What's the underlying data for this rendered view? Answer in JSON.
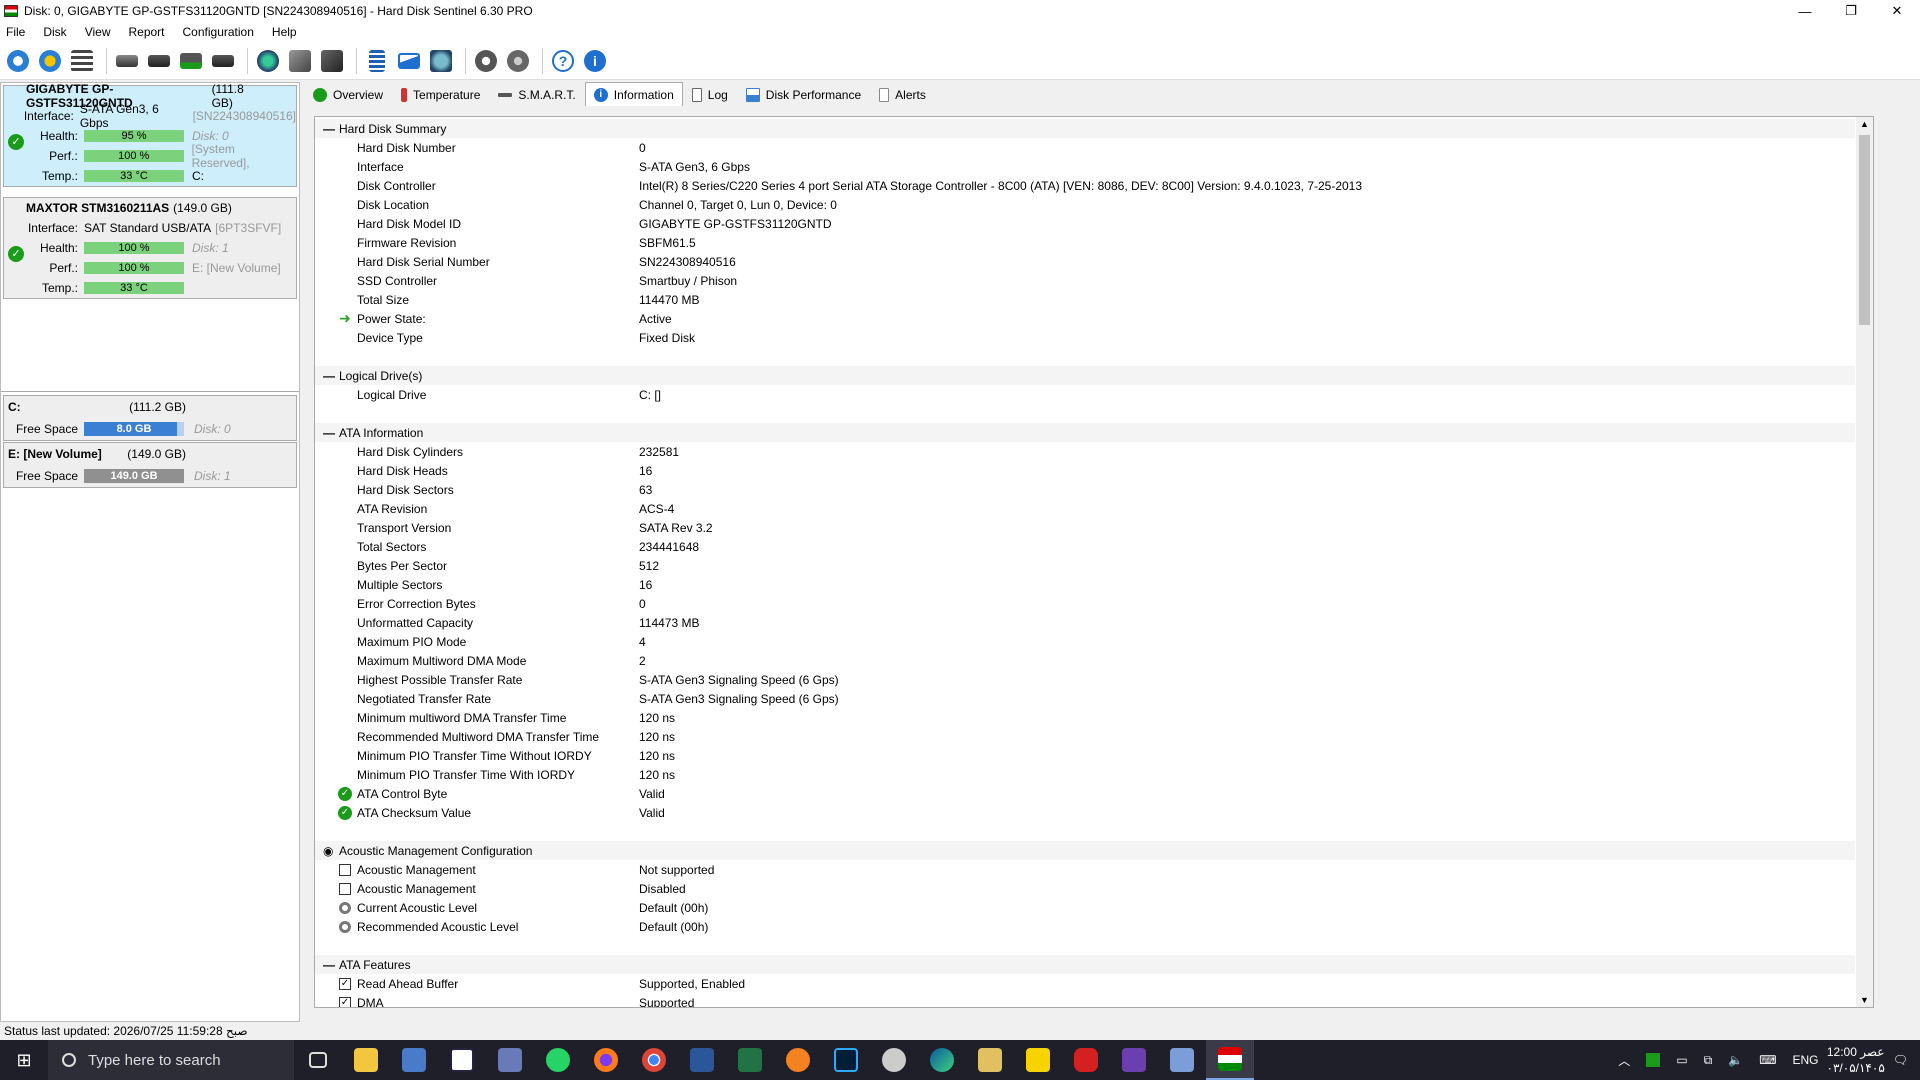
{
  "window": {
    "title": "Disk: 0, GIGABYTE GP-GSTFS31120GNTD [SN224308940516]  -  Hard Disk Sentinel 6.30 PRO",
    "controls": [
      "—",
      "❐",
      "✕"
    ]
  },
  "menu": [
    "File",
    "Disk",
    "View",
    "Report",
    "Configuration",
    "Help"
  ],
  "toolbar": {
    "icons": [
      "refresh-icon",
      "refresh-warning-icon",
      "disk-list-icon",
      "disk-icon",
      "disk-clock-icon",
      "disk-check-icon",
      "disk-search-icon",
      "globe-icon",
      "disk-tools-icon",
      "disk-export-icon",
      "report-icon",
      "mail-icon",
      "network-icon",
      "settings-icon",
      "sound-icon",
      "help-icon",
      "info-icon"
    ]
  },
  "disks": [
    {
      "name": "GIGABYTE GP-GSTFS31120GNTD",
      "size": "(111.8 GB)",
      "interface_label": "Interface:",
      "interface": "S-ATA Gen3, 6 Gbps",
      "serial": "[SN224308940516]",
      "health_label": "Health:",
      "health": "95 %",
      "disk_no": "Disk: 0",
      "perf_label": "Perf.:",
      "perf": "100 %",
      "perf_extra": "[System Reserved],",
      "temp_label": "Temp.:",
      "temp": "33 °C",
      "temp_extra": "C:"
    },
    {
      "name": "MAXTOR STM3160211AS",
      "size": "(149.0 GB)",
      "interface_label": "Interface:",
      "interface": "SAT Standard USB/ATA",
      "serial": "[6PT3SFVF]",
      "health_label": "Health:",
      "health": "100 %",
      "disk_no": "Disk: 1",
      "perf_label": "Perf.:",
      "perf": "100 %",
      "perf_extra": "E: [New Volume]",
      "temp_label": "Temp.:",
      "temp": "33 °C",
      "temp_extra": ""
    }
  ],
  "volumes": [
    {
      "name": "C:",
      "size": "(111.2 GB)",
      "free_label": "Free Space",
      "free": "8.0 GB",
      "disk": "Disk: 0",
      "color": "#3b7fd4"
    },
    {
      "name": "E: [New Volume]",
      "size": "(149.0 GB)",
      "free_label": "Free Space",
      "free": "149.0 GB",
      "disk": "Disk: 1",
      "color": "#909090"
    }
  ],
  "tabs": [
    "Overview",
    "Temperature",
    "S.M.A.R.T.",
    "Information",
    "Log",
    "Disk Performance",
    "Alerts"
  ],
  "sections": [
    {
      "title": "Hard Disk Summary",
      "items": [
        {
          "k": "Hard Disk Number",
          "v": "0"
        },
        {
          "k": "Interface",
          "v": "S-ATA Gen3, 6 Gbps"
        },
        {
          "k": "Disk Controller",
          "v": "Intel(R) 8 Series/C220 Series 4 port Serial ATA Storage Controller - 8C00 (ATA) [VEN: 8086, DEV: 8C00] Version: 9.4.0.1023, 7-25-2013"
        },
        {
          "k": "Disk Location",
          "v": "Channel 0, Target 0, Lun 0, Device: 0"
        },
        {
          "k": "Hard Disk Model ID",
          "v": "GIGABYTE GP-GSTFS31120GNTD"
        },
        {
          "k": "Firmware Revision",
          "v": "SBFM61.5"
        },
        {
          "k": "Hard Disk Serial Number",
          "v": "SN224308940516"
        },
        {
          "k": "SSD Controller",
          "v": "Smartbuy / Phison"
        },
        {
          "k": "Total Size",
          "v": "114470 MB"
        },
        {
          "k": "Power State:",
          "v": "Active"
        },
        {
          "k": "Device Type",
          "v": "Fixed Disk"
        }
      ]
    },
    {
      "title": "Logical Drive(s)",
      "items": [
        {
          "k": "Logical Drive",
          "v": "C: []"
        }
      ]
    },
    {
      "title": "ATA Information",
      "items": [
        {
          "k": "Hard Disk Cylinders",
          "v": "232581"
        },
        {
          "k": "Hard Disk Heads",
          "v": "16"
        },
        {
          "k": "Hard Disk Sectors",
          "v": "63"
        },
        {
          "k": "ATA Revision",
          "v": "ACS-4"
        },
        {
          "k": "Transport Version",
          "v": "SATA Rev 3.2"
        },
        {
          "k": "Total Sectors",
          "v": "234441648"
        },
        {
          "k": "Bytes Per Sector",
          "v": "512"
        },
        {
          "k": "Multiple Sectors",
          "v": "16"
        },
        {
          "k": "Error Correction Bytes",
          "v": "0"
        },
        {
          "k": "Unformatted Capacity",
          "v": "114473 MB"
        },
        {
          "k": "Maximum PIO Mode",
          "v": "4"
        },
        {
          "k": "Maximum Multiword DMA Mode",
          "v": "2"
        },
        {
          "k": "Highest Possible Transfer Rate",
          "v": "S-ATA Gen3 Signaling Speed (6 Gps)"
        },
        {
          "k": "Negotiated Transfer Rate",
          "v": "S-ATA Gen3 Signaling Speed (6 Gps)"
        },
        {
          "k": "Minimum multiword DMA Transfer Time",
          "v": "120 ns"
        },
        {
          "k": "Recommended Multiword DMA Transfer Time",
          "v": "120 ns"
        },
        {
          "k": "Minimum PIO Transfer Time Without IORDY",
          "v": "120 ns"
        },
        {
          "k": "Minimum PIO Transfer Time With IORDY",
          "v": "120 ns"
        },
        {
          "k": "ATA Control Byte",
          "v": "Valid"
        },
        {
          "k": "ATA Checksum Value",
          "v": "Valid"
        }
      ]
    },
    {
      "title": "Acoustic Management Configuration",
      "items": [
        {
          "k": "Acoustic Management",
          "v": "Not supported"
        },
        {
          "k": "Acoustic Management",
          "v": "Disabled"
        },
        {
          "k": "Current Acoustic Level",
          "v": "Default (00h)"
        },
        {
          "k": "Recommended Acoustic Level",
          "v": "Default (00h)"
        }
      ]
    },
    {
      "title": "ATA Features",
      "items": [
        {
          "k": "Read Ahead Buffer",
          "v": "Supported, Enabled"
        },
        {
          "k": "DMA",
          "v": "Supported"
        }
      ]
    }
  ],
  "status": "Status last updated: 2026/07/25 11:59:28 صبح",
  "taskbar": {
    "search_placeholder": "Type here to search",
    "language": "ENG",
    "time": "12:00 عصر",
    "date": "۰۳/۰۵/۱۴۰۵"
  }
}
